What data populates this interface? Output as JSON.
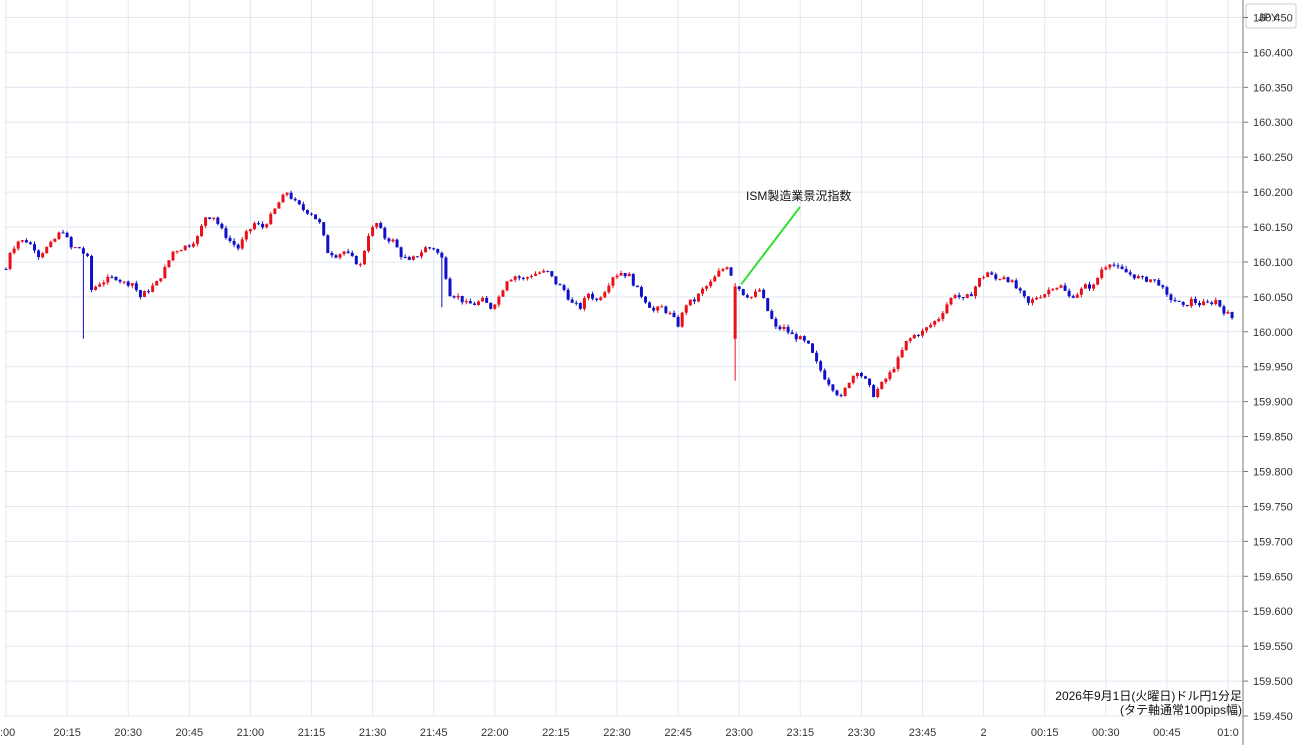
{
  "chart_data": {
    "type": "candlestick",
    "title": "",
    "xlabel": "",
    "ylabel": "",
    "currency": "JPY",
    "ylim": [
      159.45,
      160.475
    ],
    "y_ticks": [
      "160.450",
      "160.400",
      "160.350",
      "160.300",
      "160.250",
      "160.200",
      "160.150",
      "160.100",
      "160.050",
      "160.000",
      "159.950",
      "159.900",
      "159.850",
      "159.800",
      "159.750",
      "159.700",
      "159.650",
      "159.600",
      "159.550",
      "159.500",
      "159.450"
    ],
    "x_ticks": [
      ":00",
      "20:15",
      "20:30",
      "20:45",
      "21:00",
      "21:15",
      "21:30",
      "21:45",
      "22:00",
      "22:15",
      "22:30",
      "22:45",
      "23:00",
      "23:15",
      "23:30",
      "23:45",
      "2",
      "00:15",
      "00:30",
      "00:45",
      "01:0"
    ],
    "x_tick_minutes": [
      0,
      15,
      30,
      45,
      60,
      75,
      90,
      105,
      120,
      135,
      150,
      165,
      180,
      195,
      210,
      225,
      240,
      255,
      270,
      285,
      300
    ],
    "grid": true,
    "colors": {
      "up": "#e8101a",
      "down": "#1010c8",
      "grid": "#dfe9f2",
      "axis": "#777777",
      "annotation_line": "#33dd33"
    },
    "annotation": {
      "text": "ISM製造業景況指数",
      "minute": 180,
      "price": 160.068
    },
    "caption_lines": [
      "2026年9月1日(火曜日)ドル円1分足",
      "(タテ軸通常100pips幅)"
    ],
    "close_anchors": [
      [
        0,
        160.09
      ],
      [
        1,
        160.115
      ],
      [
        3,
        160.13
      ],
      [
        5,
        160.13
      ],
      [
        7,
        160.12
      ],
      [
        8,
        160.11
      ],
      [
        11,
        160.125
      ],
      [
        13,
        160.14
      ],
      [
        14,
        160.145
      ],
      [
        16,
        160.12
      ],
      [
        18,
        160.12
      ],
      [
        20,
        160.105
      ],
      [
        21,
        160.06
      ],
      [
        23,
        160.07
      ],
      [
        25,
        160.075
      ],
      [
        27,
        160.078
      ],
      [
        29,
        160.07
      ],
      [
        31,
        160.07
      ],
      [
        33,
        160.05
      ],
      [
        35,
        160.06
      ],
      [
        37,
        160.07
      ],
      [
        39,
        160.09
      ],
      [
        41,
        160.115
      ],
      [
        43,
        160.12
      ],
      [
        45,
        160.125
      ],
      [
        47,
        160.135
      ],
      [
        49,
        160.165
      ],
      [
        51,
        160.165
      ],
      [
        53,
        160.145
      ],
      [
        55,
        160.13
      ],
      [
        57,
        160.12
      ],
      [
        59,
        160.14
      ],
      [
        61,
        160.155
      ],
      [
        63,
        160.15
      ],
      [
        65,
        160.165
      ],
      [
        67,
        160.185
      ],
      [
        69,
        160.2
      ],
      [
        71,
        160.185
      ],
      [
        73,
        160.175
      ],
      [
        75,
        160.17
      ],
      [
        77,
        160.155
      ],
      [
        79,
        160.115
      ],
      [
        81,
        160.11
      ],
      [
        83,
        160.115
      ],
      [
        85,
        160.105
      ],
      [
        87,
        160.095
      ],
      [
        89,
        160.14
      ],
      [
        91,
        160.155
      ],
      [
        93,
        160.135
      ],
      [
        95,
        160.13
      ],
      [
        97,
        160.11
      ],
      [
        99,
        160.1
      ],
      [
        101,
        160.11
      ],
      [
        103,
        160.12
      ],
      [
        105,
        160.12
      ],
      [
        107,
        160.105
      ],
      [
        109,
        160.055
      ],
      [
        111,
        160.05
      ],
      [
        113,
        160.04
      ],
      [
        115,
        160.04
      ],
      [
        117,
        160.045
      ],
      [
        119,
        160.035
      ],
      [
        121,
        160.05
      ],
      [
        123,
        160.075
      ],
      [
        125,
        160.08
      ],
      [
        127,
        160.075
      ],
      [
        129,
        160.082
      ],
      [
        131,
        160.085
      ],
      [
        133,
        160.085
      ],
      [
        135,
        160.07
      ],
      [
        137,
        160.06
      ],
      [
        139,
        160.04
      ],
      [
        141,
        160.035
      ],
      [
        143,
        160.055
      ],
      [
        145,
        160.045
      ],
      [
        147,
        160.06
      ],
      [
        149,
        160.08
      ],
      [
        151,
        160.085
      ],
      [
        153,
        160.08
      ],
      [
        155,
        160.06
      ],
      [
        157,
        160.045
      ],
      [
        159,
        160.03
      ],
      [
        161,
        160.035
      ],
      [
        163,
        160.025
      ],
      [
        165,
        160.01
      ],
      [
        167,
        160.04
      ],
      [
        169,
        160.045
      ],
      [
        171,
        160.06
      ],
      [
        173,
        160.07
      ],
      [
        175,
        160.085
      ],
      [
        177,
        160.095
      ],
      [
        179,
        160.07
      ],
      [
        181,
        160.055
      ],
      [
        183,
        160.05
      ],
      [
        185,
        160.06
      ],
      [
        187,
        160.03
      ],
      [
        189,
        160.005
      ],
      [
        191,
        160.005
      ],
      [
        193,
        159.995
      ],
      [
        195,
        159.99
      ],
      [
        197,
        159.98
      ],
      [
        199,
        159.955
      ],
      [
        201,
        159.935
      ],
      [
        203,
        159.92
      ],
      [
        205,
        159.905
      ],
      [
        207,
        159.93
      ],
      [
        209,
        159.945
      ],
      [
        211,
        159.93
      ],
      [
        213,
        159.91
      ],
      [
        215,
        159.925
      ],
      [
        217,
        159.94
      ],
      [
        219,
        159.96
      ],
      [
        221,
        159.985
      ],
      [
        223,
        159.995
      ],
      [
        225,
        160.0
      ],
      [
        227,
        160.01
      ],
      [
        229,
        160.02
      ],
      [
        231,
        160.04
      ],
      [
        233,
        160.055
      ],
      [
        235,
        160.045
      ],
      [
        237,
        160.055
      ],
      [
        239,
        160.075
      ],
      [
        241,
        160.085
      ],
      [
        243,
        160.075
      ],
      [
        245,
        160.08
      ],
      [
        247,
        160.07
      ],
      [
        249,
        160.055
      ],
      [
        251,
        160.04
      ],
      [
        253,
        160.05
      ],
      [
        255,
        160.055
      ],
      [
        257,
        160.065
      ],
      [
        259,
        160.065
      ],
      [
        261,
        160.05
      ],
      [
        263,
        160.055
      ],
      [
        265,
        160.065
      ],
      [
        267,
        160.065
      ],
      [
        269,
        160.09
      ],
      [
        271,
        160.1
      ],
      [
        273,
        160.09
      ],
      [
        275,
        160.085
      ],
      [
        277,
        160.08
      ],
      [
        279,
        160.075
      ],
      [
        281,
        160.075
      ],
      [
        283,
        160.07
      ],
      [
        285,
        160.05
      ],
      [
        287,
        160.045
      ],
      [
        289,
        160.035
      ],
      [
        291,
        160.045
      ],
      [
        293,
        160.04
      ],
      [
        295,
        160.04
      ],
      [
        297,
        160.045
      ],
      [
        299,
        160.03
      ],
      [
        301,
        160.02
      ]
    ],
    "spikes": [
      {
        "minute": 19,
        "low": 159.99
      },
      {
        "minute": 107,
        "low": 160.035
      },
      {
        "minute": 179,
        "low": 159.93,
        "up": true
      }
    ]
  }
}
